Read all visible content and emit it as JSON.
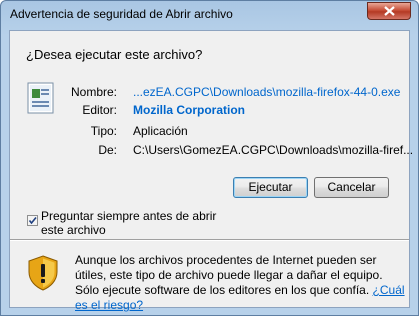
{
  "window": {
    "title": "Advertencia de seguridad de Abrir archivo"
  },
  "dialog": {
    "question": "¿Desea ejecutar este archivo?",
    "fields": {
      "name_label": "Nombre:",
      "name_value": "...ezEA.CGPC\\Downloads\\mozilla-firefox-44-0.exe",
      "publisher_label": "Editor:",
      "publisher_value": "Mozilla Corporation",
      "type_label": "Tipo:",
      "type_value": "Aplicación",
      "from_label": "De:",
      "from_value": "C:\\Users\\GomezEA.CGPC\\Downloads\\mozilla-firef..."
    },
    "buttons": {
      "run": "Ejecutar",
      "cancel": "Cancelar"
    },
    "checkbox": {
      "label": "Preguntar siempre antes de abrir este archivo",
      "checked": true
    },
    "warning": {
      "text": "Aunque los archivos procedentes de Internet pueden ser útiles, este tipo de archivo puede llegar a dañar el equipo. Sólo ejecute software de los editores en los que confía.",
      "link": "¿Cuál es el riesgo?"
    }
  }
}
